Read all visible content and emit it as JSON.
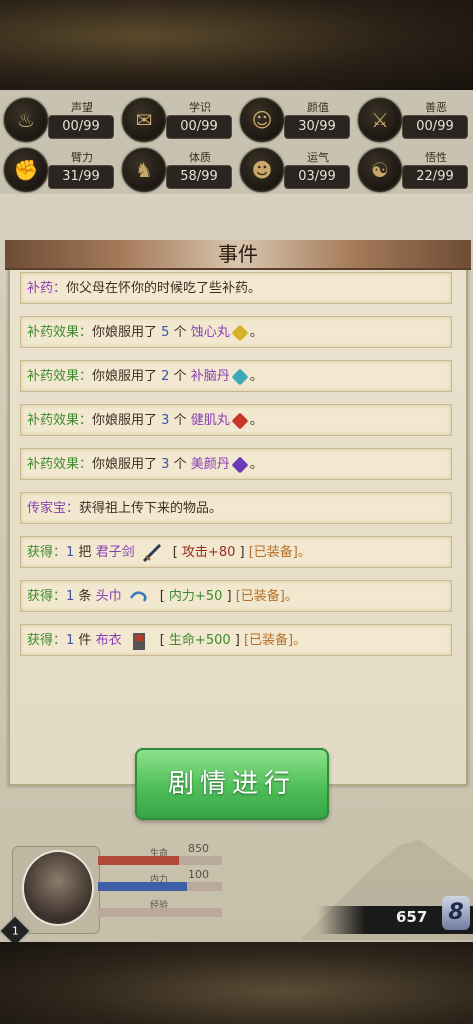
{
  "stats": [
    {
      "label": "声望",
      "value": "00/99",
      "icon": "reputation-icon",
      "glyph": "♨"
    },
    {
      "label": "学识",
      "value": "00/99",
      "icon": "scroll-icon",
      "glyph": "✉"
    },
    {
      "label": "颜值",
      "value": "30/99",
      "icon": "face-icon",
      "glyph": "☺"
    },
    {
      "label": "善恶",
      "value": "00/99",
      "icon": "crossed-swords-icon",
      "glyph": "⚔"
    },
    {
      "label": "臂力",
      "value": "31/99",
      "icon": "arm-icon",
      "glyph": "✊"
    },
    {
      "label": "体质",
      "value": "58/99",
      "icon": "body-icon",
      "glyph": "♞"
    },
    {
      "label": "运气",
      "value": "03/99",
      "icon": "luck-icon",
      "glyph": "☻"
    },
    {
      "label": "悟性",
      "value": "22/99",
      "icon": "insight-icon",
      "glyph": "☯"
    }
  ],
  "event_panel": {
    "title": "事件",
    "rows": [
      {
        "tag": "补药：",
        "text": "你父母在怀你的时候吃了些补药。"
      },
      {
        "tag": "补药效果：",
        "pre": "你娘服用了 ",
        "num": "5",
        "mid": " 个 ",
        "item": "蚀心丸",
        "pill_color": "#d8b22a",
        "post": " 。"
      },
      {
        "tag": "补药效果：",
        "pre": "你娘服用了 ",
        "num": "2",
        "mid": " 个 ",
        "item": "补脑丹",
        "pill_color": "#3aa8b8",
        "post": " 。"
      },
      {
        "tag": "补药效果：",
        "pre": "你娘服用了 ",
        "num": "3",
        "mid": " 个 ",
        "item": "健肌丸",
        "pill_color": "#c8362a",
        "post": " 。"
      },
      {
        "tag": "补药效果：",
        "pre": "你娘服用了 ",
        "num": "3",
        "mid": " 个 ",
        "item": "美颜丹",
        "pill_color": "#6a3ab8",
        "post": " 。"
      },
      {
        "tag": "传家宝：",
        "text": "获得祖上传下来的物品。"
      },
      {
        "tag": "获得：",
        "num": "1",
        "unit": " 把 ",
        "item": "君子剑",
        "icon": "sword-icon",
        "stat": "攻击+80",
        "equip": "[已装备]。"
      },
      {
        "tag": "获得：",
        "num": "1",
        "unit": " 条 ",
        "item": "头巾",
        "icon": "headband-icon",
        "stat": "内力+50",
        "equip": "[已装备]。"
      },
      {
        "tag": "获得：",
        "num": "1",
        "unit": " 件 ",
        "item": "布衣",
        "icon": "cloth-armor-icon",
        "stat": "生命+500",
        "equip": "[已装备]。"
      }
    ]
  },
  "story_button": "剧情进行",
  "hud": {
    "hp_label": "生命",
    "hp_value": "850",
    "hp_fraction": 0.65,
    "mp_label": "内力",
    "mp_value": "100",
    "mp_fraction": 0.72,
    "exp_label": "经验",
    "exp_fraction": 0.0,
    "level": "1",
    "coins": "657",
    "coin_symbol": "8"
  }
}
